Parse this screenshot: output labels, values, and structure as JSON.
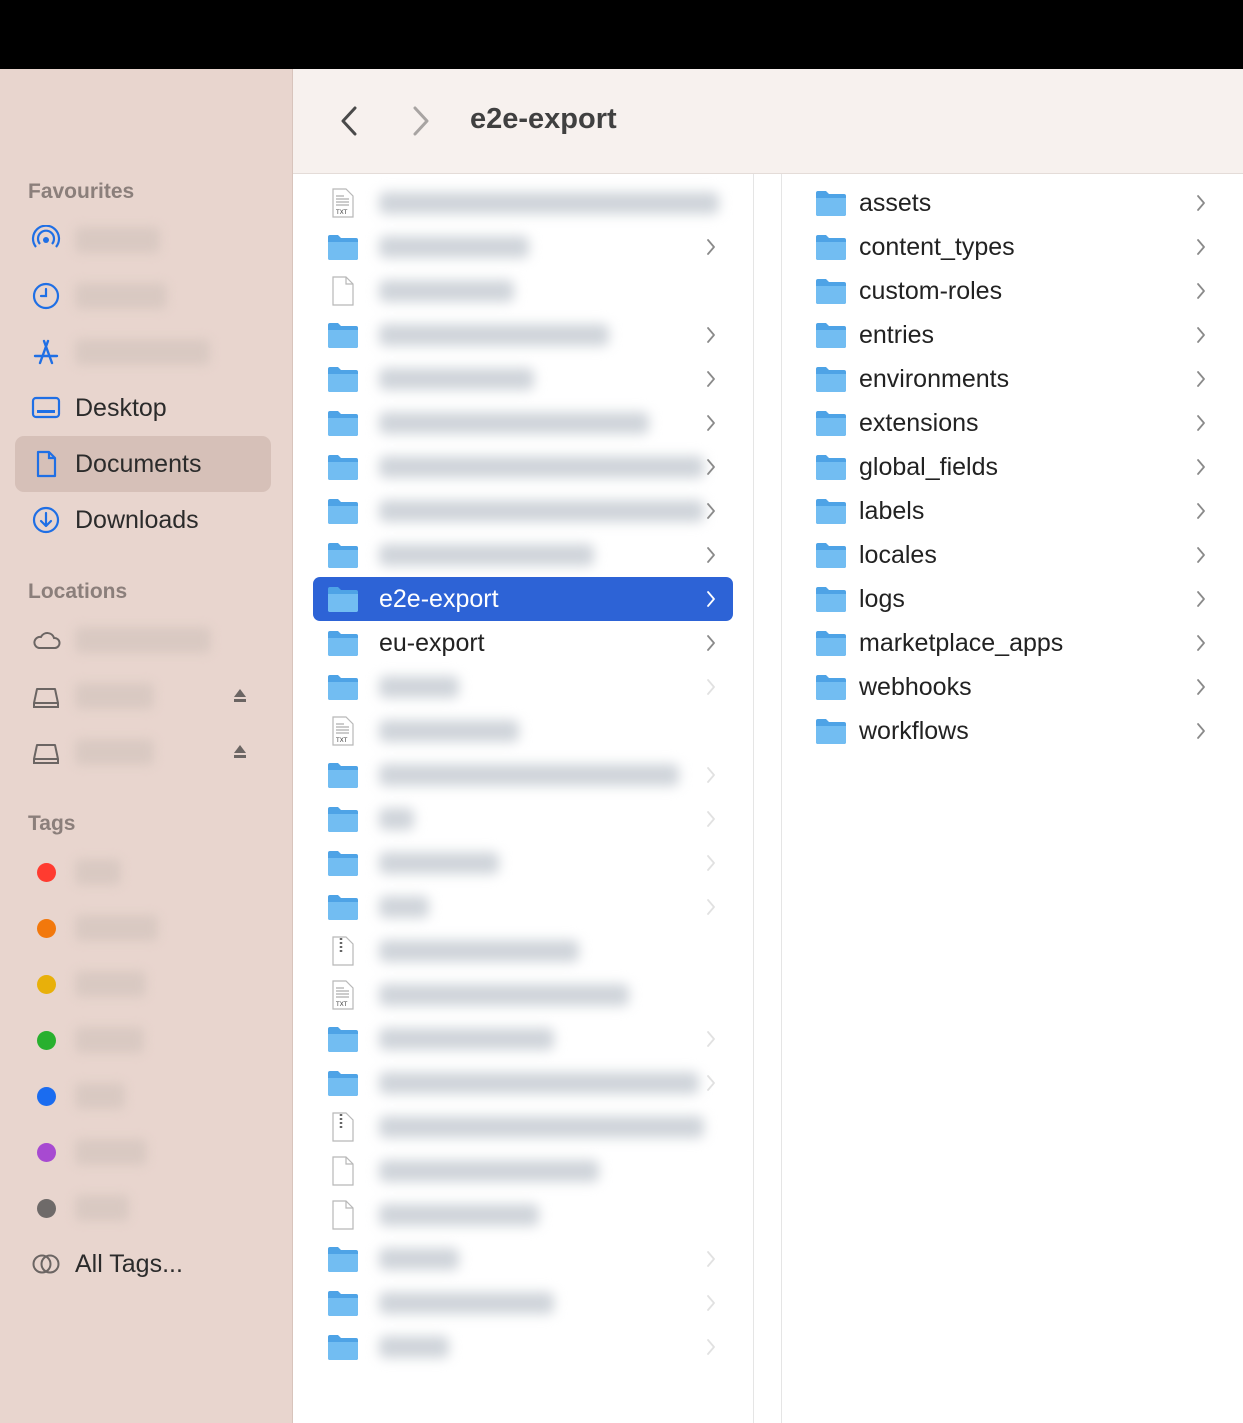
{
  "toolbar": {
    "title": "e2e-export"
  },
  "sidebar": {
    "favourites_title": "Favourites",
    "favourites": [
      {
        "label": "AirDrop",
        "icon": "airdrop-icon",
        "blurred": true
      },
      {
        "label": "Recents",
        "icon": "clock-icon",
        "blurred": true
      },
      {
        "label": "Applications",
        "icon": "applications-icon",
        "blurred": true
      },
      {
        "label": "Desktop",
        "icon": "desktop-icon",
        "blurred": false
      },
      {
        "label": "Documents",
        "icon": "document-icon",
        "blurred": false,
        "selected": true
      },
      {
        "label": "Downloads",
        "icon": "download-icon",
        "blurred": false
      }
    ],
    "locations_title": "Locations",
    "locations": [
      {
        "label": "iCloud Drive",
        "icon": "cloud-icon",
        "blurred": true
      },
      {
        "label": "Docker",
        "icon": "drive-icon",
        "blurred": true
      },
      {
        "label": "Docker",
        "icon": "drive-icon",
        "blurred": true
      }
    ],
    "tags_title": "Tags",
    "tags": [
      {
        "label": "Red",
        "color": "#ff3b30"
      },
      {
        "label": "Orange",
        "color": "#f2780c"
      },
      {
        "label": "Yellow",
        "color": "#e8b00a"
      },
      {
        "label": "Green",
        "color": "#28b02e"
      },
      {
        "label": "Blue",
        "color": "#1a6cf0"
      },
      {
        "label": "Purple",
        "color": "#a74ad1"
      },
      {
        "label": "Grey",
        "color": "#6e6a69"
      }
    ],
    "all_tags": "All Tags..."
  },
  "column1": {
    "items": [
      {
        "label": "",
        "type": "txt",
        "blurred": true,
        "chevron": false
      },
      {
        "label": "",
        "type": "folder",
        "blurred": true,
        "chevron": true
      },
      {
        "label": "",
        "type": "file",
        "blurred": true,
        "chevron": false
      },
      {
        "label": "",
        "type": "folder",
        "blurred": true,
        "chevron": true
      },
      {
        "label": "",
        "type": "folder",
        "blurred": true,
        "chevron": true
      },
      {
        "label": "",
        "type": "folder",
        "blurred": true,
        "chevron": true
      },
      {
        "label": "",
        "type": "folder",
        "blurred": true,
        "chevron": true
      },
      {
        "label": "",
        "type": "folder",
        "blurred": true,
        "chevron": true
      },
      {
        "label": "",
        "type": "folder",
        "blurred": true,
        "chevron": true
      },
      {
        "label": "e2e-export",
        "type": "folder",
        "blurred": false,
        "chevron": true,
        "selected": true
      },
      {
        "label": "eu-export",
        "type": "folder",
        "blurred": false,
        "chevron": true
      },
      {
        "label": "",
        "type": "folder",
        "blurred": true,
        "chevron": true,
        "faint": true
      },
      {
        "label": "",
        "type": "txt",
        "blurred": true,
        "chevron": false
      },
      {
        "label": "",
        "type": "folder",
        "blurred": true,
        "chevron": true,
        "faint": true
      },
      {
        "label": "",
        "type": "folder",
        "blurred": true,
        "chevron": true,
        "faint": true
      },
      {
        "label": "",
        "type": "folder",
        "blurred": true,
        "chevron": true,
        "faint": true
      },
      {
        "label": "",
        "type": "folder",
        "blurred": true,
        "chevron": true,
        "faint": true
      },
      {
        "label": "",
        "type": "zip",
        "blurred": true,
        "chevron": false
      },
      {
        "label": "",
        "type": "txt",
        "blurred": true,
        "chevron": false
      },
      {
        "label": "",
        "type": "folder",
        "blurred": true,
        "chevron": true,
        "faint": true
      },
      {
        "label": "",
        "type": "folder",
        "blurred": true,
        "chevron": true,
        "faint": true
      },
      {
        "label": "",
        "type": "zip",
        "blurred": true,
        "chevron": false
      },
      {
        "label": "",
        "type": "file",
        "blurred": true,
        "chevron": false
      },
      {
        "label": "",
        "type": "file",
        "blurred": true,
        "chevron": false
      },
      {
        "label": "",
        "type": "folder",
        "blurred": true,
        "chevron": true,
        "faint": true
      },
      {
        "label": "",
        "type": "folder",
        "blurred": true,
        "chevron": true,
        "faint": true
      },
      {
        "label": "",
        "type": "folder",
        "blurred": true,
        "chevron": true,
        "faint": true
      }
    ]
  },
  "column3": {
    "items": [
      {
        "label": "assets"
      },
      {
        "label": "content_types"
      },
      {
        "label": "custom-roles"
      },
      {
        "label": "entries"
      },
      {
        "label": "environments"
      },
      {
        "label": "extensions"
      },
      {
        "label": "global_fields"
      },
      {
        "label": "labels"
      },
      {
        "label": "locales"
      },
      {
        "label": "logs"
      },
      {
        "label": "marketplace_apps"
      },
      {
        "label": "webhooks"
      },
      {
        "label": "workflows"
      }
    ]
  }
}
